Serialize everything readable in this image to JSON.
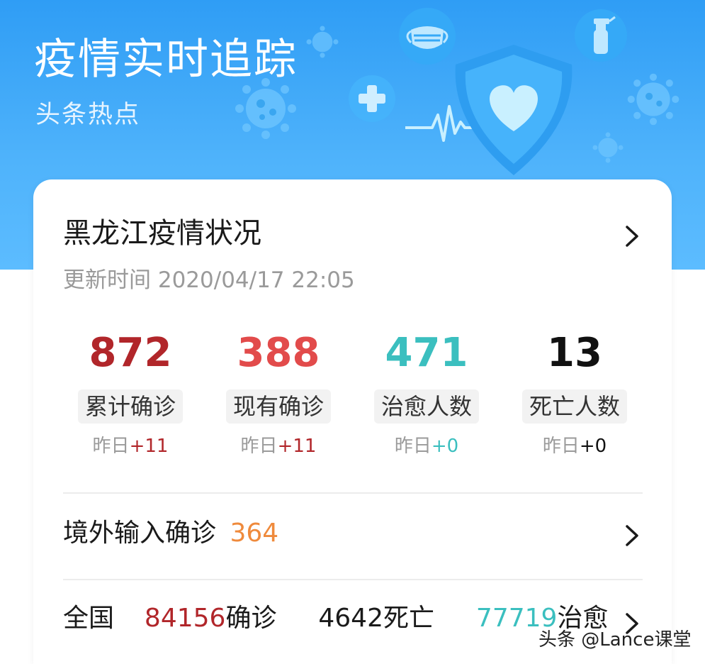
{
  "banner": {
    "title": "疫情实时追踪",
    "subtitle": "头条热点"
  },
  "region": {
    "title": "黑龙江疫情状况",
    "update_label": "更新时间",
    "update_time": "2020/04/17 22:05"
  },
  "stats": [
    {
      "value": "872",
      "label": "累计确诊",
      "delta_prefix": "昨日",
      "delta": "+11",
      "color": "#b1262a",
      "delta_color": "#b1262a"
    },
    {
      "value": "388",
      "label": "现有确诊",
      "delta_prefix": "昨日",
      "delta": "+11",
      "color": "#e24b4b",
      "delta_color": "#b1262a"
    },
    {
      "value": "471",
      "label": "治愈人数",
      "delta_prefix": "昨日",
      "delta": "+0",
      "color": "#3bbfbf",
      "delta_color": "#3bbfbf"
    },
    {
      "value": "13",
      "label": "死亡人数",
      "delta_prefix": "昨日",
      "delta": "+0",
      "color": "#111111",
      "delta_color": "#111111"
    }
  ],
  "imported": {
    "label": "境外输入确诊",
    "value": "364",
    "color": "#ef8a3c"
  },
  "national": {
    "label": "全国",
    "confirmed_value": "84156",
    "confirmed_label": "确诊",
    "deaths_value": "4642",
    "deaths_label": "死亡",
    "recovered_value": "77719",
    "recovered_label": "治愈",
    "confirmed_color": "#b1262a",
    "recovered_color": "#3bbfbf"
  },
  "watermark": "头条 @Lance课堂",
  "icons": [
    "virus-icon",
    "mask-icon",
    "spray-bottle-icon",
    "medical-cross-icon",
    "shield-heart-icon",
    "heartbeat-line-icon",
    "chevron-right-icon"
  ]
}
